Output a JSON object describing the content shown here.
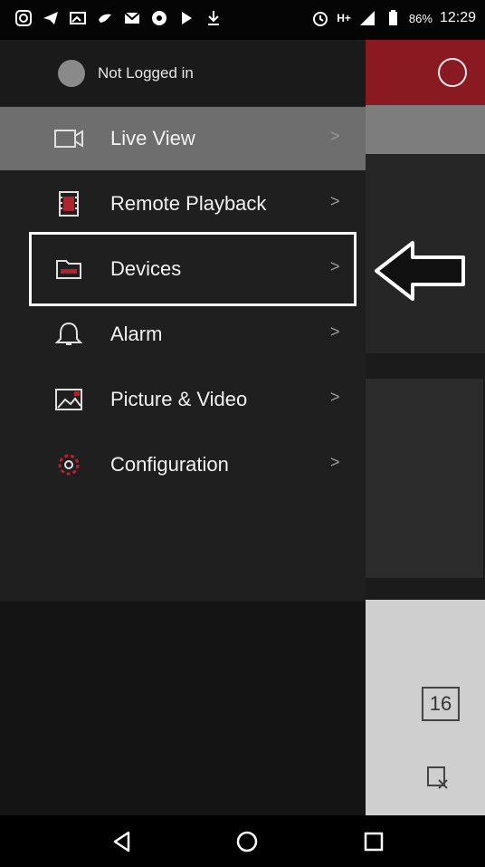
{
  "status_bar": {
    "battery": "86%",
    "time": "12:29",
    "network": "H+"
  },
  "drawer": {
    "user": {
      "label": "Not Logged in"
    },
    "items": [
      {
        "label": "Live View",
        "chevron": ">",
        "icon": "video-camera-icon",
        "active": true
      },
      {
        "label": "Remote Playback",
        "chevron": ">",
        "icon": "film-icon"
      },
      {
        "label": "Devices",
        "chevron": ">",
        "icon": "device-folder-icon",
        "highlighted": true
      },
      {
        "label": "Alarm",
        "chevron": ">",
        "icon": "bell-icon"
      },
      {
        "label": "Picture & Video",
        "chevron": ">",
        "icon": "picture-icon"
      },
      {
        "label": "Configuration",
        "chevron": ">",
        "icon": "settings-gear-icon"
      }
    ]
  },
  "background": {
    "layout_button_label": "16"
  },
  "colors": {
    "accent": "#8a1a22",
    "active_item": "#6e6e6e",
    "drawer_bg": "#1f1f1f"
  }
}
